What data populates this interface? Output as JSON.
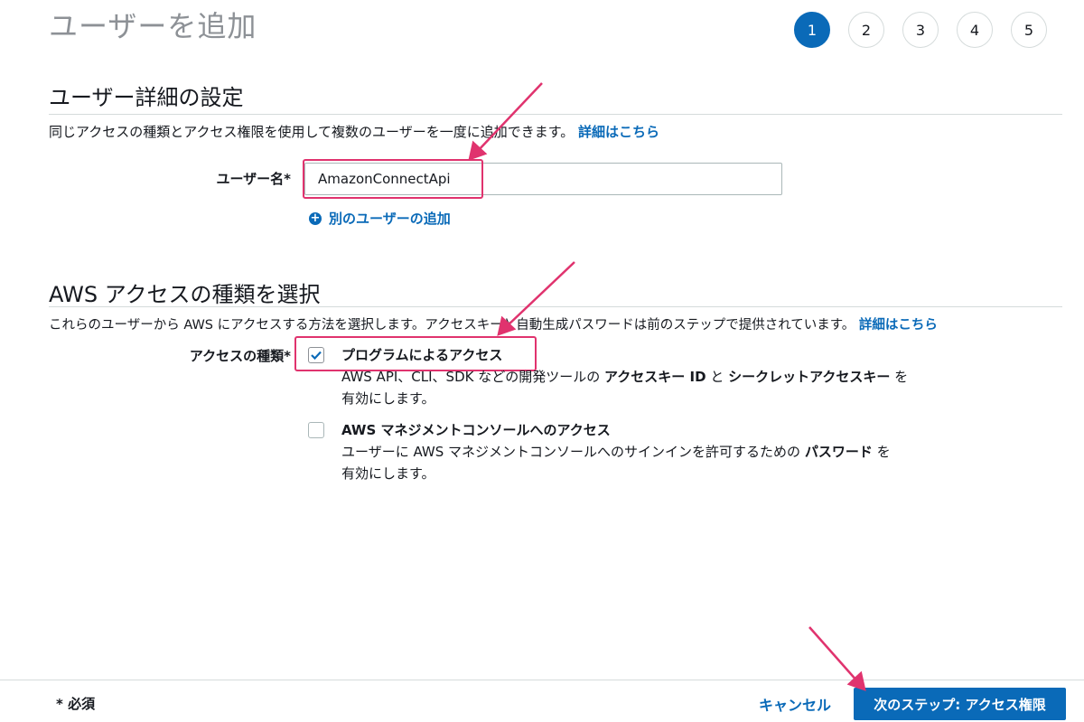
{
  "page": {
    "title": "ユーザーを追加"
  },
  "steps": [
    "1",
    "2",
    "3",
    "4",
    "5"
  ],
  "active_step": "1",
  "user_details": {
    "heading": "ユーザー詳細の設定",
    "description": "同じアクセスの種類とアクセス権限を使用して複数のユーザーを一度に追加できます。",
    "learn_more": "詳細はこちら",
    "username_label": "ユーザー名*",
    "username_value": "AmazonConnectApi",
    "add_another_user": "別のユーザーの追加"
  },
  "access_type": {
    "heading": "AWS アクセスの種類を選択",
    "description": "これらのユーザーから AWS にアクセスする方法を選択します。アクセスキーと自動生成パスワードは前のステップで提供されています。",
    "learn_more": "詳細はこちら",
    "label": "アクセスの種類*",
    "programmatic": {
      "title": "プログラムによるアクセス",
      "desc_prefix": "AWS API、CLI、SDK などの開発ツールの",
      "desc_bold1": "アクセスキー ID",
      "desc_mid": "と",
      "desc_bold2": "シークレットアクセスキー",
      "desc_suffix": "を",
      "desc_line2": "有効にします。",
      "checked": true
    },
    "console": {
      "title": "AWS マネジメントコンソールへのアクセス",
      "desc_prefix": "ユーザーに AWS マネジメントコンソールへのサインインを許可するための",
      "desc_bold": "パスワード",
      "desc_suffix": "を",
      "desc_line2": "有効にします。",
      "checked": false
    }
  },
  "footer": {
    "required_note": "* 必須",
    "cancel": "キャンセル",
    "next": "次のステップ: アクセス権限"
  },
  "colors": {
    "accent": "#0a6ab8",
    "highlight": "#e0336e"
  },
  "icons": {
    "add_user": "plus-circle-icon",
    "checkmark": "checkmark-icon",
    "annotation": "arrow-icon"
  }
}
